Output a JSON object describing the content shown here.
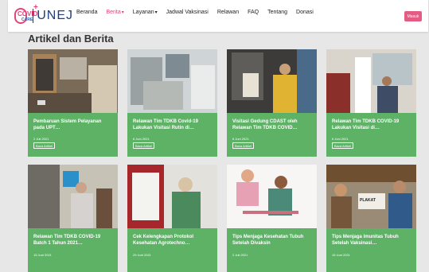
{
  "logo": {
    "top": "COVID",
    "bottom": "CARE",
    "text": "UNEJ"
  },
  "nav": {
    "items": [
      {
        "label": "Beranda"
      },
      {
        "label": "Berita",
        "active": true
      },
      {
        "label": "Layanan"
      },
      {
        "label": "Jadwal Vaksinasi"
      },
      {
        "label": "Relawan"
      },
      {
        "label": "FAQ"
      },
      {
        "label": "Tentang"
      },
      {
        "label": "Donasi"
      }
    ],
    "login": "Masuk"
  },
  "section": {
    "title": "Artikel dan Berita"
  },
  "articles": [
    {
      "title": "Pembaruan Sistem Pelayanan pada UPT…",
      "date": "2 Juli 2021",
      "button": "Baca Artikel"
    },
    {
      "title": "Relawan Tim TDKB Covid-19 Lakukan Visitasi Rutin di…",
      "date": "6 Juni 2021",
      "button": "Baca Artikel"
    },
    {
      "title": "Visitasi Gedung CDAST oleh Relawan Tim TDKB COVID…",
      "date": "6 Juni 2021",
      "button": "Baca Artikel"
    },
    {
      "title": "Relawan Tim TDKB COVID-19 Lakukan Visitasi di…",
      "date": "6 Juni 2021",
      "button": "Baca Artikel"
    },
    {
      "title": "Relawan Tim TDKB COVID-19 Batch 1 Tahun 2021…",
      "date": "15 Juni 2021",
      "button": "Baca Artikel"
    },
    {
      "title": "Cek Kelengkapan Protokol Kesehatan Agrotechno…",
      "date": "29 Juni 2021",
      "button": "Baca Artikel"
    },
    {
      "title": "Tips Menjaga Kesehatan Tubuh Setelah Divaksin",
      "date": "2 Juli 2021",
      "button": "Baca Artikel"
    },
    {
      "title": "Tips Menjaga Imunitas Tubuh Setelah Vaksinasi…",
      "date": "15 Juni 2021",
      "button": "Baca Artikel"
    }
  ],
  "images": {
    "caption_8": "PLAKAT"
  },
  "colors": {
    "accent": "#e0457b",
    "card": "#5db266",
    "brand": "#1f3f7a"
  }
}
